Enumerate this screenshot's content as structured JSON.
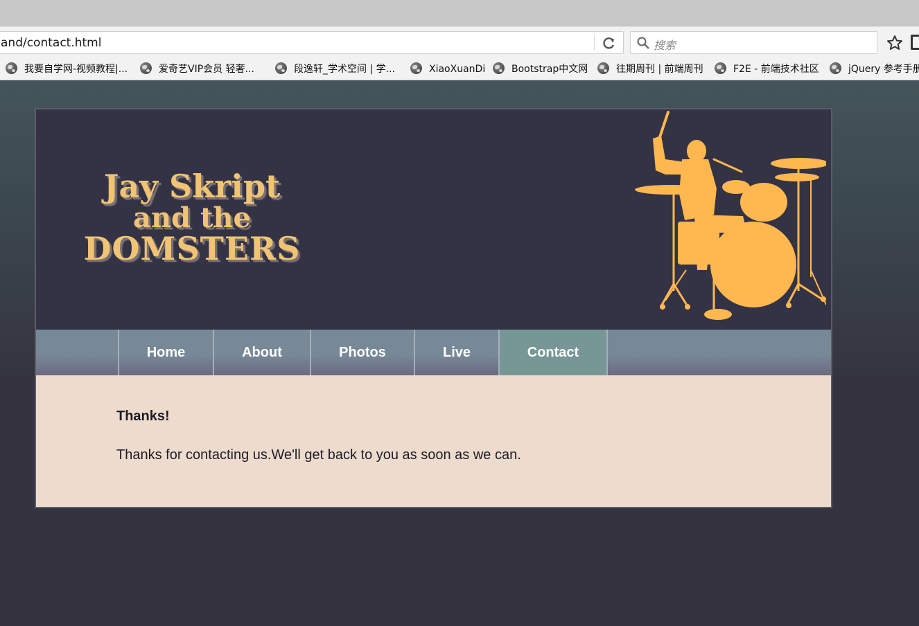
{
  "browser": {
    "url": "and/contact.html",
    "search_placeholder": "搜索",
    "bookmarks": [
      {
        "label": "我要自学网-视频教程|..."
      },
      {
        "label": "爱奇艺VIP会员 轻奢..."
      },
      {
        "label": "段逸轩_学术空间 | 学..."
      },
      {
        "label": "XiaoXuanDi"
      },
      {
        "label": "Bootstrap中文网"
      },
      {
        "label": "往期周刊 | 前端周刊"
      },
      {
        "label": "F2E - 前端技术社区"
      },
      {
        "label": "jQuery 参考手册"
      }
    ]
  },
  "site": {
    "logo": {
      "line1": "Jay Skript",
      "line2": "and the",
      "line3": "DOMSTERS"
    },
    "nav": {
      "items": [
        {
          "label": "Home"
        },
        {
          "label": "About"
        },
        {
          "label": "Photos"
        },
        {
          "label": "Live"
        },
        {
          "label": "Contact"
        }
      ],
      "active": "Contact"
    },
    "content": {
      "title": "Thanks!",
      "message": "Thanks for contacting us.We'll get back to you as soon as we can."
    }
  },
  "colors": {
    "accent": "#ffb84f",
    "nav_active": "#779796",
    "content_bg": "#eddccd",
    "header_bg": "#343345"
  },
  "icons": {
    "reload": "reload-icon",
    "search": "search-icon",
    "star": "star-icon",
    "bookmark": "globe-icon",
    "drummer": "drummer-silhouette-icon"
  }
}
